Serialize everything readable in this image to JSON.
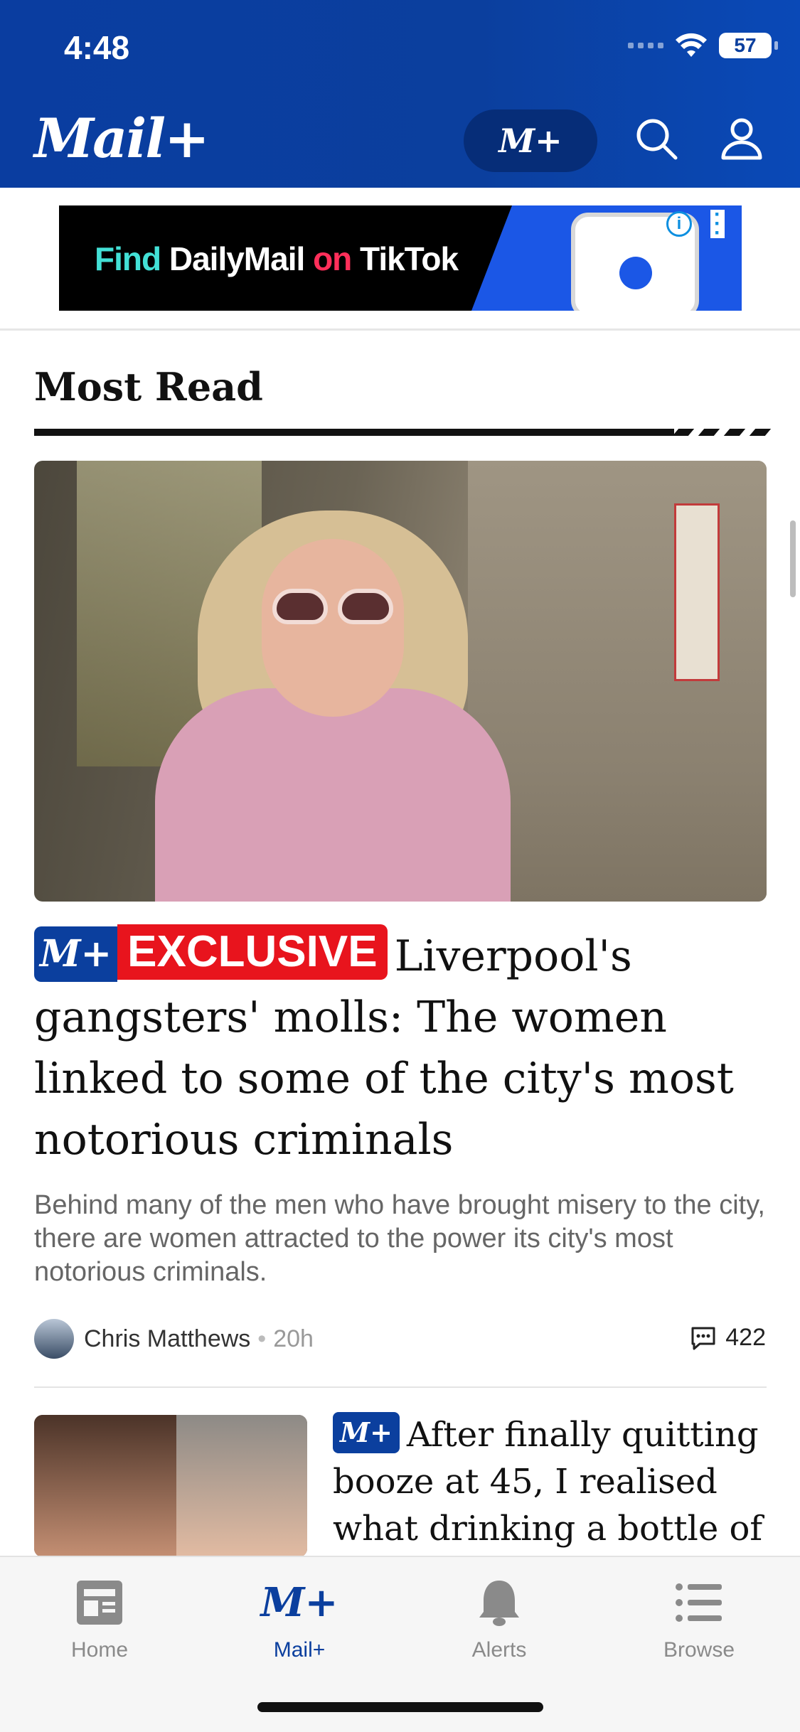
{
  "status": {
    "time": "4:48",
    "battery": "57"
  },
  "header": {
    "logo": "Mail+",
    "mplus_button": "M+"
  },
  "ad": {
    "find": "Find",
    "brand": "DailyMail",
    "on": "on",
    "platform": "TikTok",
    "info": "i"
  },
  "section": {
    "title": "Most Read"
  },
  "lead_article": {
    "badge": "M+",
    "exclusive": "EXCLUSIVE",
    "headline": "Liverpool's gangsters' molls: The women linked to some of the city's most notorious criminals",
    "standfirst": "Behind many of the men who have brought misery to the city, there are women attracted to the power its city's most notorious criminals.",
    "author": "Chris Matthews",
    "separator": "•",
    "age": "20h",
    "comments": "422"
  },
  "second_article": {
    "badge": "M+",
    "headline": "After finally quitting booze at 45, I realised what drinking a bottle of"
  },
  "tabbar": {
    "tabs": [
      {
        "label": "Home"
      },
      {
        "label": "Mail+",
        "icon_text": "M+"
      },
      {
        "label": "Alerts"
      },
      {
        "label": "Browse"
      }
    ],
    "active": "Mail+"
  },
  "colors": {
    "brand": "#0b3f9e",
    "exclusive": "#e8141d"
  }
}
